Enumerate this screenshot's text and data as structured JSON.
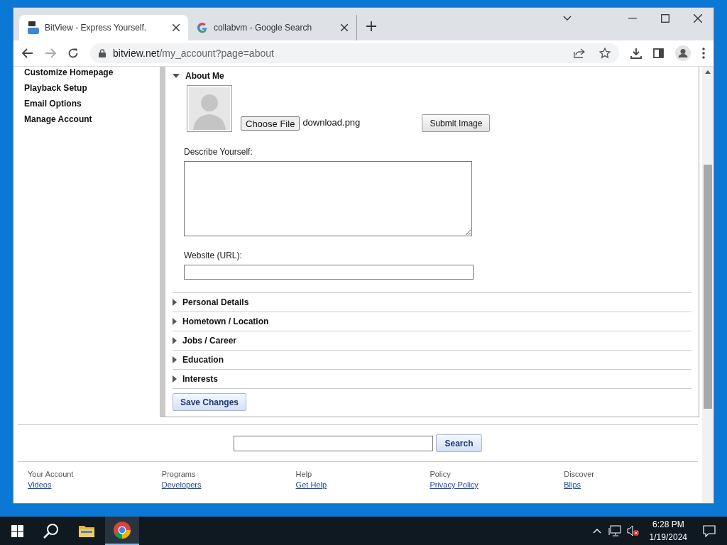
{
  "browser": {
    "tabs": [
      {
        "title": "BitView - Express Yourself.",
        "kind": "bitview",
        "selected": true
      },
      {
        "title": "collabvm - Google Search",
        "kind": "google",
        "selected": false
      }
    ],
    "address": {
      "domain": "bitview.net",
      "path": "/my_account?page=about"
    }
  },
  "sidebar": {
    "items": [
      "Customize Homepage",
      "Playback Setup",
      "Email Options",
      "Manage Account"
    ]
  },
  "sections": [
    {
      "title": "About Me",
      "expanded": true
    },
    {
      "title": "Personal Details",
      "expanded": false
    },
    {
      "title": "Hometown / Location",
      "expanded": false
    },
    {
      "title": "Jobs / Career",
      "expanded": false
    },
    {
      "title": "Education",
      "expanded": false
    },
    {
      "title": "Interests",
      "expanded": false
    }
  ],
  "about": {
    "choose_file": "Choose File",
    "file_name": "download.png",
    "submit": "Submit Image",
    "describe_label": "Describe Yourself:",
    "website_label": "Website (URL):"
  },
  "save_button": "Save Changes",
  "search_button": "Search",
  "footer": [
    {
      "heading": "Your Account",
      "link": "Videos"
    },
    {
      "heading": "Programs",
      "link": "Developers"
    },
    {
      "heading": "Help",
      "link": "Get Help"
    },
    {
      "heading": "Policy",
      "link": "Privacy Policy"
    },
    {
      "heading": "Discover",
      "link": "Blips"
    }
  ],
  "taskbar": {
    "time": "6:28 PM",
    "date": "1/19/2024"
  }
}
